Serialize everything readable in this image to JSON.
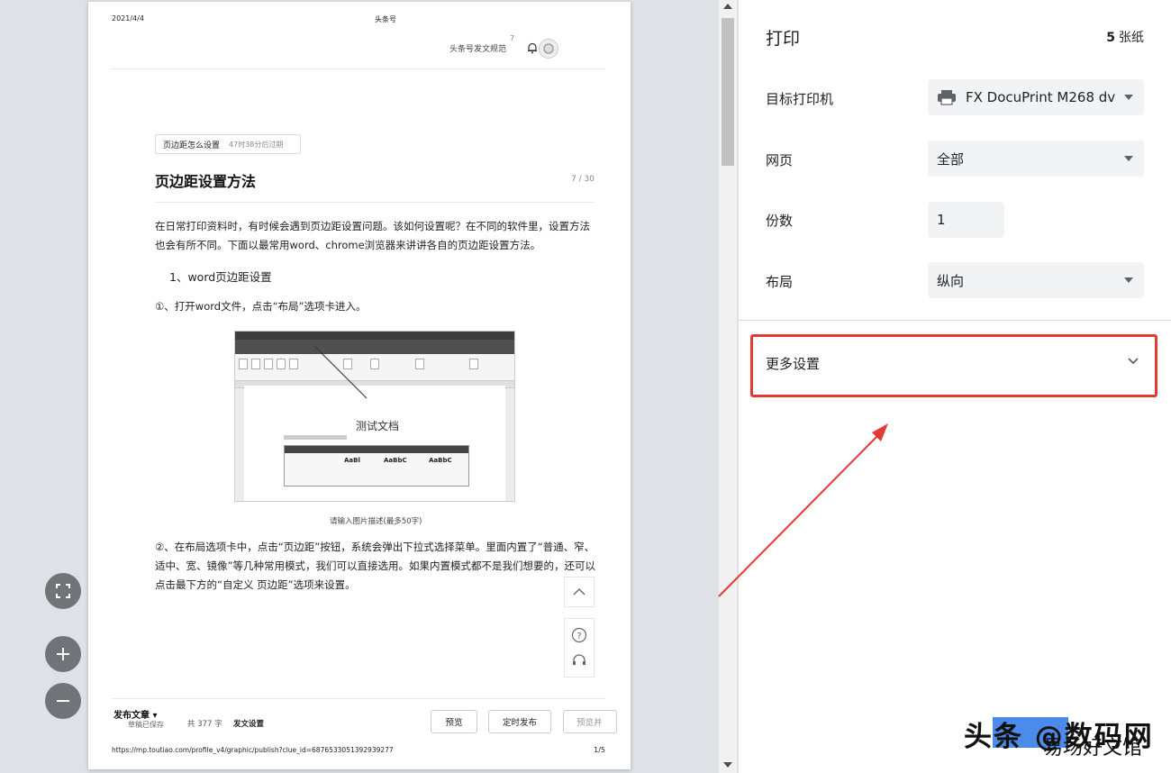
{
  "page": {
    "date": "2021/4/4",
    "site_name": "头条号",
    "nav_spec": "头条号发文规范",
    "nav_message": "消息",
    "message_count": "7",
    "topic_label": "页边距怎么设置",
    "topic_remaining": "47时38分后过期",
    "article_title": "页边距设置方法",
    "title_count": "7 / 30",
    "intro": "在日常打印资料时，有时候会遇到页边距设置问题。该如何设置呢？在不同的软件里，设置方法也会有所不同。下面以最常用word、chrome浏览器来讲讲各自的页边距设置方法。",
    "heading1": "1、word页边距设置",
    "step1": "①、打开word文件，点击“布局”选项卡进入。",
    "image_doc_title": "测试文档",
    "image_caption": "请输入图片描述(最多50字)",
    "step2": "②、在布局选项卡中，点击“页边距”按钮，系统会弹出下拉式选择菜单。里面内置了“普通、窄、适中、宽、镜像”等几种常用模式，我们可以直接选用。如果内置模式都不是我们想要的，还可以点击最下方的“自定义 页边距”选项来设置。",
    "footer": {
      "publish": "发布文章",
      "draft": "草稿已保存",
      "word_count": "共 377 字",
      "settings": "发文设置",
      "preview": "预览",
      "schedule": "定时发布",
      "preview_publish": "预览并",
      "url": "https://mp.toutiao.com/profile_v4/graphic/publish?clue_id=6876533051392939277",
      "page_num": "1/5"
    }
  },
  "print": {
    "title": "打印",
    "sheets_count": "5",
    "sheets_unit": "张纸",
    "destination_label": "目标打印机",
    "destination_value": "FX DocuPrint M268 dv",
    "pages_label": "网页",
    "pages_value": "全部",
    "copies_label": "份数",
    "copies_value": "1",
    "layout_label": "布局",
    "layout_value": "纵向",
    "more_settings": "更多设置"
  },
  "watermark": {
    "line1": "头条 @数码网",
    "line2": "易场好文馆"
  },
  "colors": {
    "highlight": "#e53935",
    "zoom_button": "#707479"
  }
}
